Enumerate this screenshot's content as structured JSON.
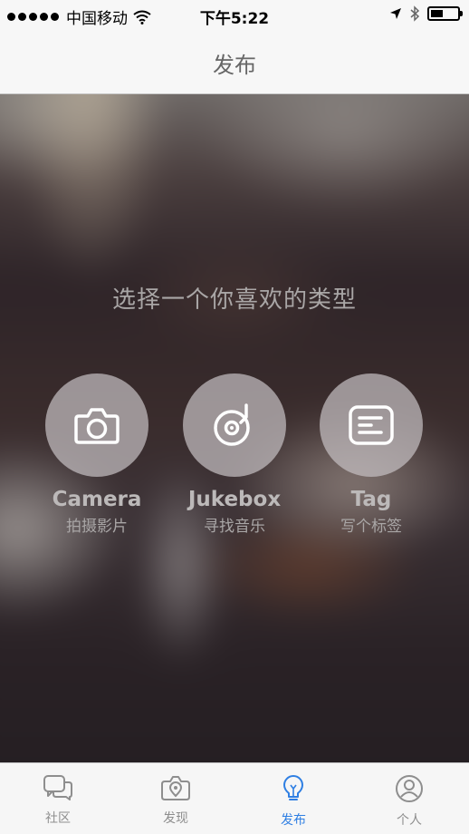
{
  "status_bar": {
    "carrier": "中国移动",
    "time": "下午5:22",
    "battery_level": 0.45
  },
  "nav": {
    "title": "发布"
  },
  "prompt": "选择一个你喜欢的类型",
  "options": [
    {
      "title": "Camera",
      "subtitle": "拍摄影片",
      "icon": "camera-icon"
    },
    {
      "title": "Jukebox",
      "subtitle": "寻找音乐",
      "icon": "record-icon"
    },
    {
      "title": "Tag",
      "subtitle": "写个标签",
      "icon": "tag-icon"
    }
  ],
  "tabs": [
    {
      "label": "社区",
      "icon": "chat-bubbles-icon",
      "active": false
    },
    {
      "label": "发现",
      "icon": "camera-location-icon",
      "active": false
    },
    {
      "label": "发布",
      "icon": "lightbulb-icon",
      "active": true
    },
    {
      "label": "个人",
      "icon": "user-icon",
      "active": false
    }
  ],
  "colors": {
    "accent": "#2f7fe3",
    "tab_inactive": "#8e8e8e"
  }
}
